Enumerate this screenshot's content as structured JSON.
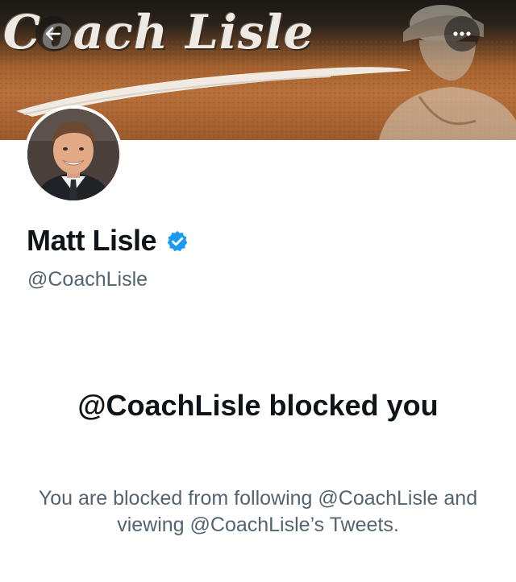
{
  "header": {
    "banner_logo_text": "Coach Lisle",
    "back_icon": "back-arrow-icon",
    "more_icon": "more-options-icon"
  },
  "profile": {
    "name": "Matt Lisle",
    "handle": "@CoachLisle",
    "verified": true
  },
  "blocked_notice": {
    "title": "@CoachLisle blocked you",
    "message": "You are blocked from following @CoachLisle and viewing @CoachLisle’s Tweets."
  },
  "colors": {
    "primary_text": "#0f1419",
    "secondary_text": "#536471",
    "verified_blue": "#1d9bf0",
    "background": "#ffffff"
  }
}
